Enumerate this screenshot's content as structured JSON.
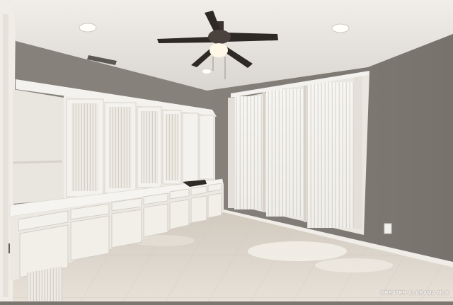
{
  "photo": {
    "subject": "empty-room-interior",
    "watermark_text": "GREATER ALABAMA MLS",
    "colors": {
      "ceiling": "#ece8e2",
      "wall": "#7e7a74",
      "cabinet": "#f1eee8",
      "floor": "#ddd6cc",
      "window_light": "#f6f6f2",
      "fan_blade": "#2f2925"
    }
  }
}
